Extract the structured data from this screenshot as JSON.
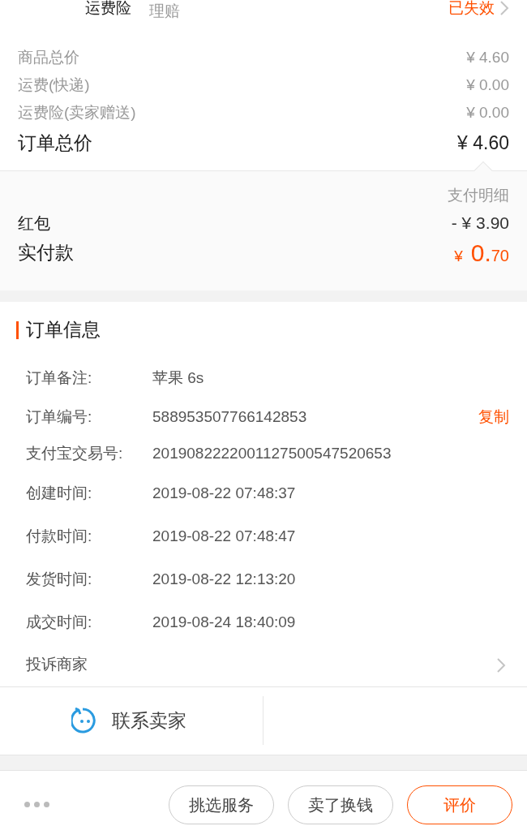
{
  "insurance_row": {
    "label": "运费险",
    "note": "理赔",
    "status": "已失效"
  },
  "price_rows": [
    {
      "label": "商品总价",
      "value": "¥ 4.60"
    },
    {
      "label": "运费(快递)",
      "value": "¥ 0.00"
    },
    {
      "label": "运费险(卖家赠送)",
      "value": "¥ 0.00"
    }
  ],
  "order_total": {
    "label": "订单总价",
    "value": "¥ 4.60"
  },
  "payment": {
    "detail_link": "支付明细",
    "red_packet": {
      "label": "红包",
      "value": "- ¥ 3.90"
    },
    "paid": {
      "label": "实付款",
      "currency": "¥",
      "integer": "0.",
      "decimals": "70"
    }
  },
  "order_info": {
    "title": "订单信息",
    "rows": [
      {
        "label": "订单备注:",
        "value": "苹果 6s"
      },
      {
        "label": "订单编号:",
        "value": "588953507766142853",
        "action": "复制"
      },
      {
        "label": "支付宝交易号:",
        "value": "2019082222001127500547520653"
      },
      {
        "label": "创建时间:",
        "value": "2019-08-22 07:48:37"
      },
      {
        "label": "付款时间:",
        "value": "2019-08-22 07:48:47"
      },
      {
        "label": "发货时间:",
        "value": "2019-08-22 12:13:20"
      },
      {
        "label": "成交时间:",
        "value": "2019-08-24 18:40:09"
      }
    ],
    "complaint": "投诉商家"
  },
  "contact_seller": "联系卖家",
  "bottom_buttons": [
    {
      "label": "挑选服务",
      "primary": false
    },
    {
      "label": "卖了换钱",
      "primary": false
    },
    {
      "label": "评价",
      "primary": true
    }
  ]
}
